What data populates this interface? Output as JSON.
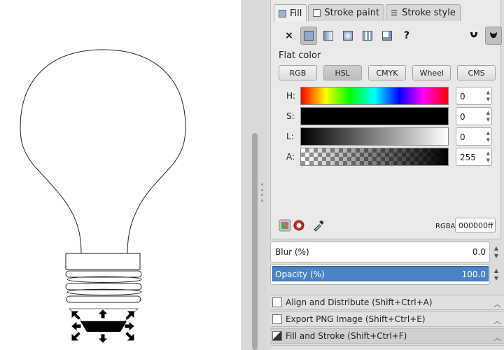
{
  "tabs": {
    "fill": "Fill",
    "stroke_paint": "Stroke paint",
    "stroke_style": "Stroke style"
  },
  "paint_modes": {
    "none": "×",
    "unset": "?"
  },
  "flat_color_title": "Flat color",
  "color_modes": [
    "RGB",
    "HSL",
    "CMYK",
    "Wheel",
    "CMS"
  ],
  "selected_color_mode": "HSL",
  "channels": {
    "h": {
      "label": "H:",
      "value": "0"
    },
    "s": {
      "label": "S:",
      "value": "0"
    },
    "l": {
      "label": "L:",
      "value": "0"
    },
    "a": {
      "label": "A:",
      "value": "255"
    }
  },
  "rgba": {
    "label": "RGBA:",
    "value": "000000ff"
  },
  "blur": {
    "label": "Blur (%)",
    "value": "0.0"
  },
  "opacity": {
    "label": "Opacity (%)",
    "value": "100.0"
  },
  "docked_panels": [
    {
      "label": "Align and Distribute (Shift+Ctrl+A)"
    },
    {
      "label": "Export PNG Image (Shift+Ctrl+E)"
    },
    {
      "label": "Fill and Stroke (Shift+Ctrl+F)"
    }
  ],
  "colors": {
    "accent": "#4b84c6",
    "selected_fill": "#000000"
  }
}
